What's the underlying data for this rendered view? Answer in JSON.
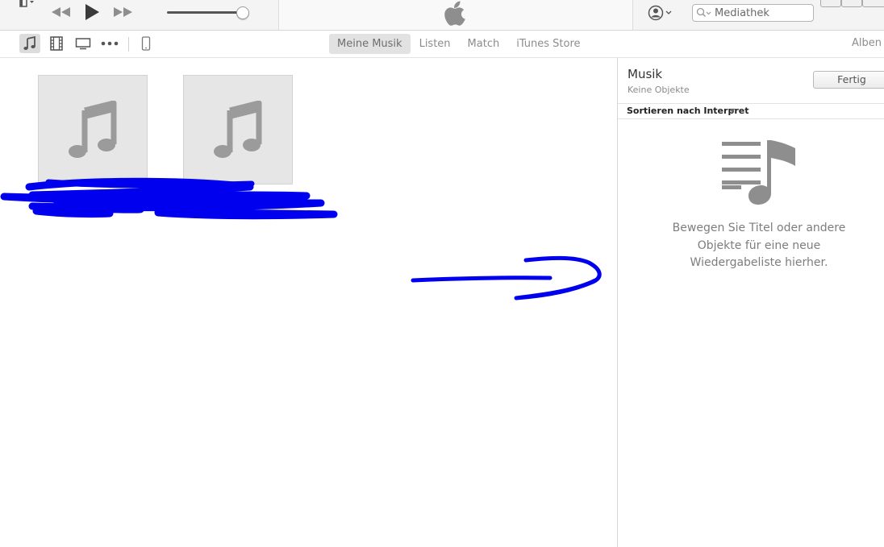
{
  "player": {
    "search_placeholder": "Mediathek",
    "icons": {
      "menu": "library-menu-icon",
      "previous": "rewind-icon",
      "play": "play-icon",
      "next": "fast-forward-icon",
      "lcd": "apple-logo-icon",
      "account": "account-icon",
      "search": "search-icon"
    }
  },
  "nav": {
    "media_icons": [
      "music-note-icon",
      "movie-film-icon",
      "tv-icon",
      "more-dots-icon",
      "iphone-device-icon"
    ],
    "tabs": [
      {
        "label": "Meine Musik",
        "active": true
      },
      {
        "label": "Listen",
        "active": false
      },
      {
        "label": "Match",
        "active": false
      },
      {
        "label": "iTunes Store",
        "active": false
      }
    ],
    "view_label": "Alben"
  },
  "library": {
    "albums": [
      {
        "artwork": "music-note-placeholder"
      },
      {
        "artwork": "music-note-placeholder"
      }
    ]
  },
  "playlist_panel": {
    "title": "Musik",
    "subtitle": "Keine Objekte",
    "done_label": "Fertig",
    "sort_label": "Sortieren nach Interpret",
    "empty_icon": "playlist-music-icon",
    "empty_message": "Bewegen Sie Titel oder andere\nObjekte für eine neue\nWiedergabeliste hierher."
  },
  "annotations": {
    "scribble_color": "#0000ee"
  },
  "colors": {
    "accent_gray": "#8e8e8e",
    "toolbar_bg": "#f4f4f4",
    "active_tab_bg": "#e2e2e2"
  }
}
